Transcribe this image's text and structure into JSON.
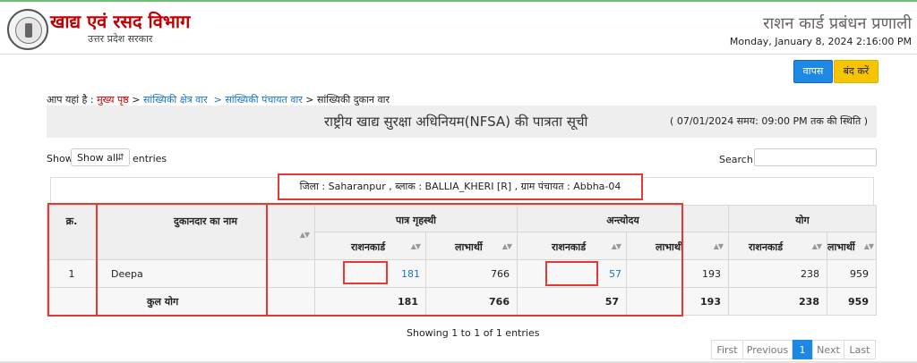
{
  "header": {
    "title": "खाद्य एवं रसद विभाग",
    "subtitle": "उत्तर प्रदेश सरकार",
    "system_title": "राशन कार्ड प्रबंधन प्रणाली",
    "datetime": "Monday, January 8, 2024 2:16:00 PM"
  },
  "buttons": {
    "back": "वापस",
    "close": "बंद करें"
  },
  "breadcrumb": {
    "prefix": "आप यहां है :",
    "home": "मुख्य पृष्ठ",
    "sep1": ">",
    "area": "सांख्यिकी क्षेत्र वार",
    "panchayat": "> सांख्यिकी पंचायत वार",
    "current": "> सांख्यिकी दुकान वार"
  },
  "report": {
    "title": "राष्ट्रीय खाद्य सुरक्षा अधिनियम(NFSA) की पात्रता सूची",
    "status": "( 07/01/2024 समय: 09:00 PM तक की स्थिति )"
  },
  "controls": {
    "show_label": "Show",
    "show_value": "Show all",
    "entries_label": "entries",
    "search_label": "Search:"
  },
  "location_info": "जिला : Saharanpur , ब्लाक : BALLIA_KHERI [R] , ग्राम पंचायत : Abbha-04",
  "table": {
    "col_sno": "क्र.",
    "col_shop": "दुकानदार का नाम",
    "group_eligible": "पात्र गृहस्थी",
    "group_antyodaya": "अन्त्योदय",
    "group_total": "योग",
    "sub_ration": "राशनकार्ड",
    "sub_beneficiary": "लाभार्थी",
    "row": {
      "sno": "1",
      "name": "Deepa",
      "eligible_ration": "181",
      "eligible_benef": "766",
      "antyodaya_ration": "57",
      "antyodaya_benef": "193",
      "total_ration": "238",
      "total_benef": "959"
    },
    "total_row": {
      "label": "कुल योग",
      "eligible_ration": "181",
      "eligible_benef": "766",
      "antyodaya_ration": "57",
      "antyodaya_benef": "193",
      "total_ration": "238",
      "total_benef": "959"
    }
  },
  "footer": {
    "showing": "Showing 1 to 1 of 1 entries",
    "first": "First",
    "previous": "Previous",
    "page": "1",
    "next": "Next",
    "last": "Last"
  },
  "colors": {
    "brand_red": "#c00000",
    "link_blue": "#1e73be",
    "highlight_red": "#e53935",
    "button_blue": "#1e88e5",
    "button_yellow": "#f7c400"
  }
}
